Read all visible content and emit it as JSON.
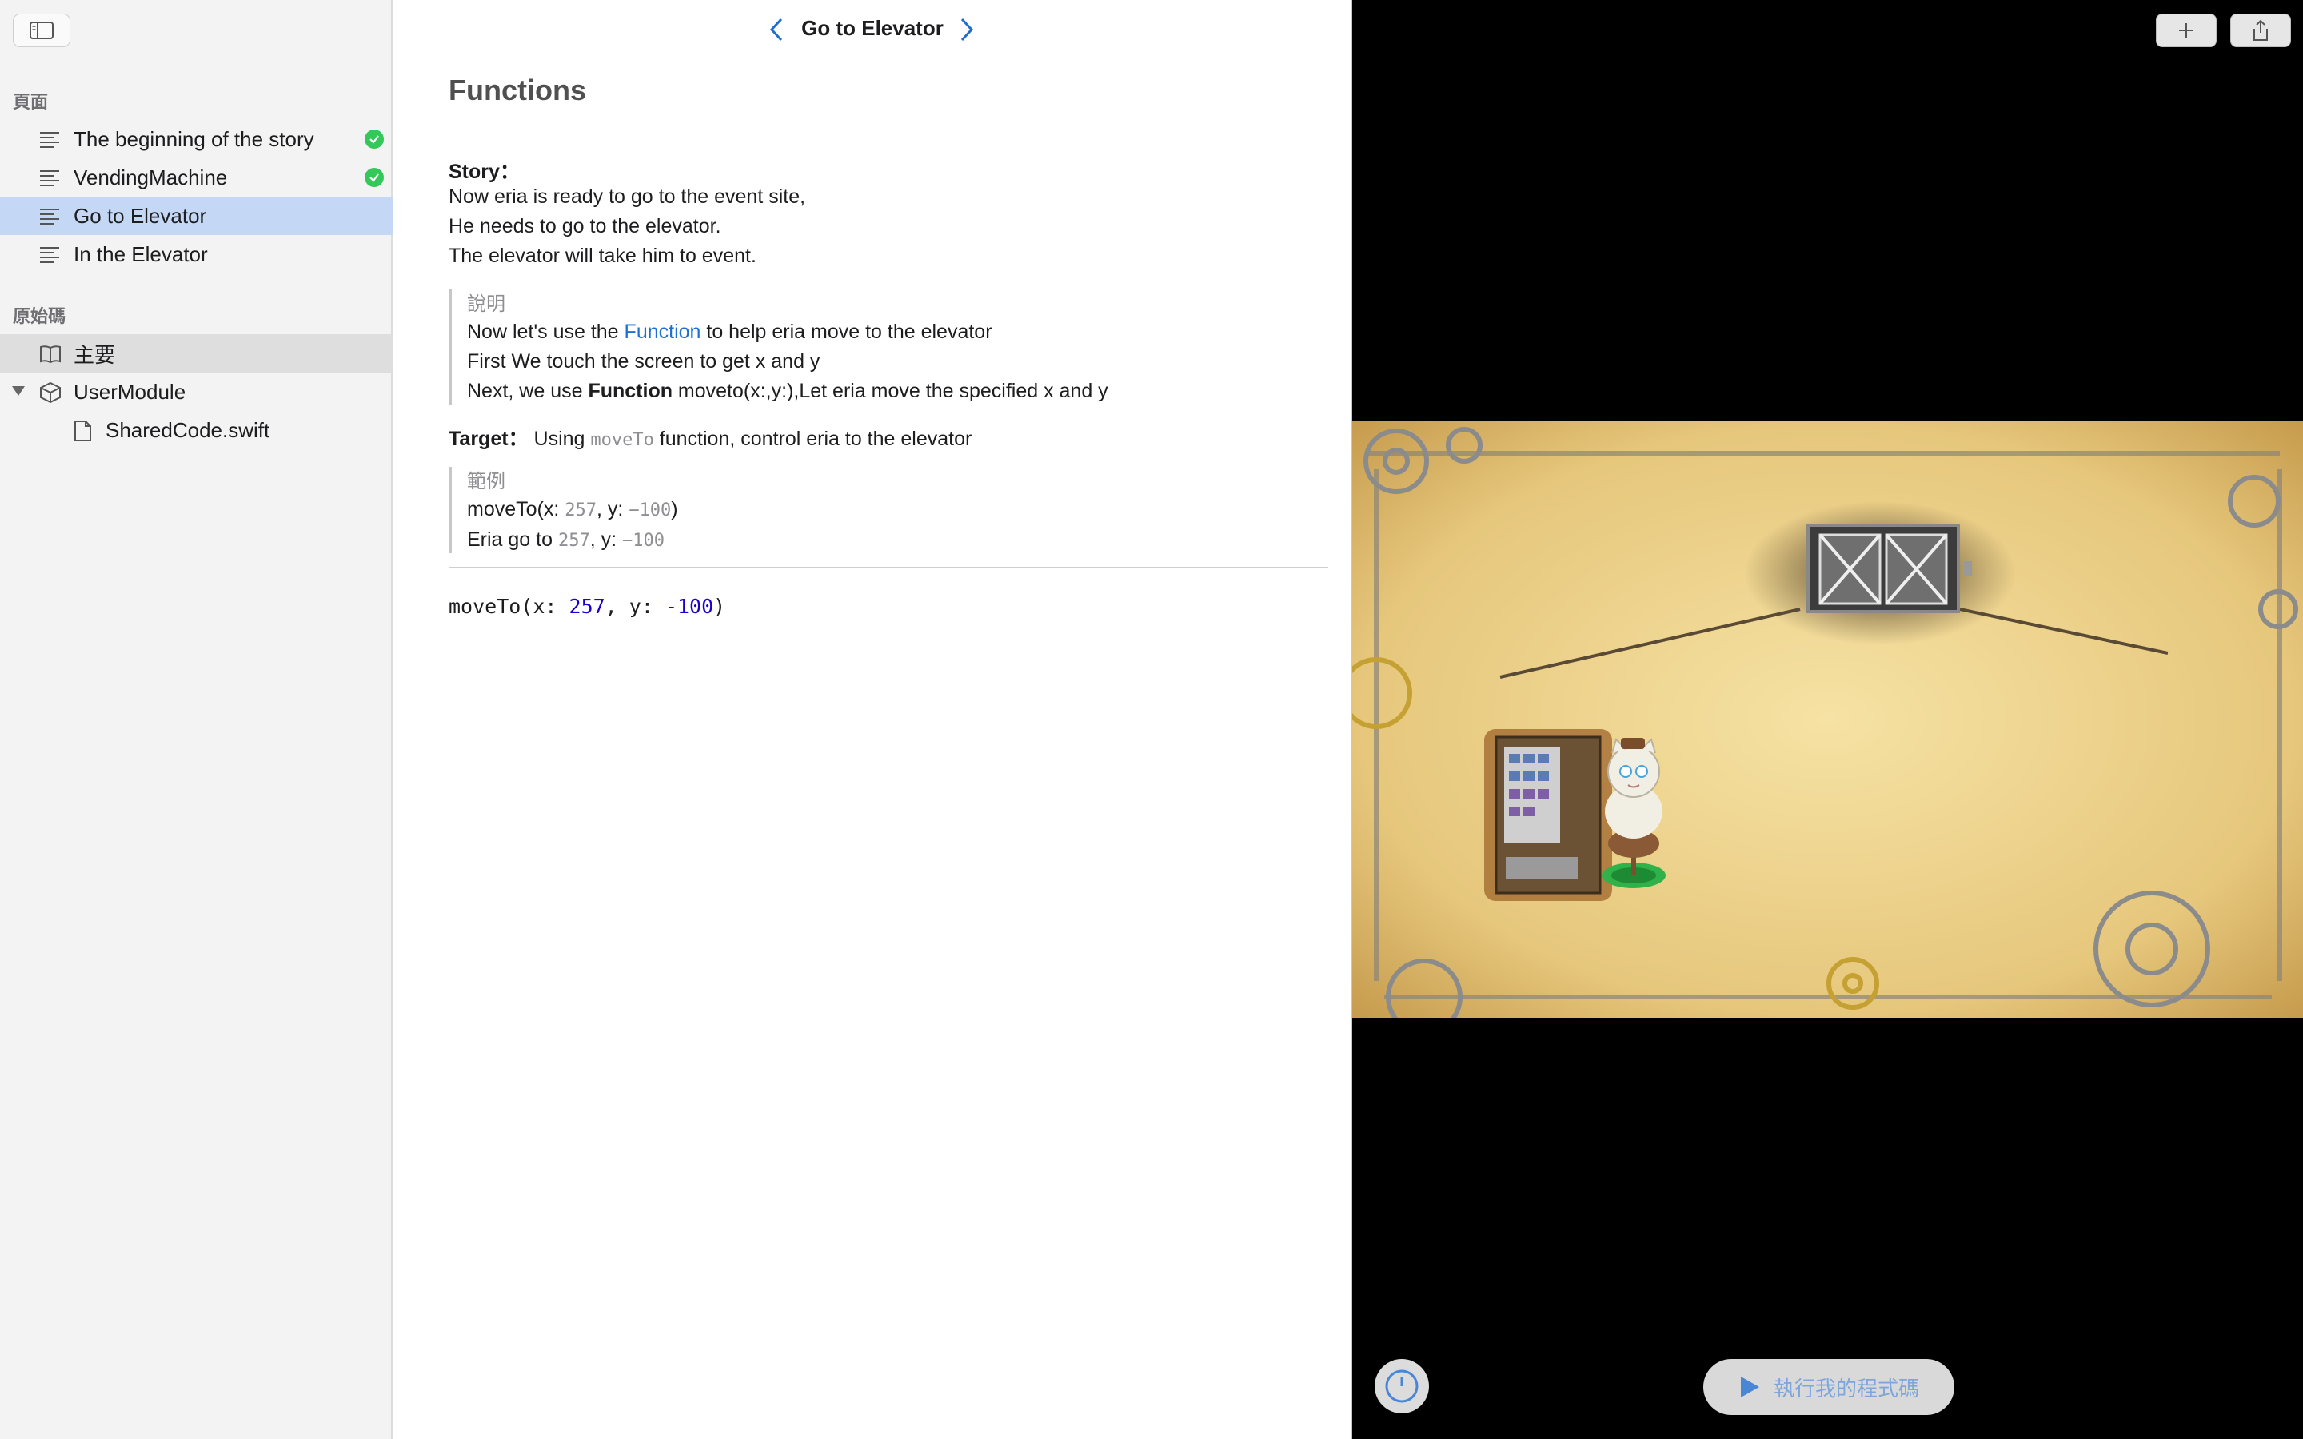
{
  "sidebar": {
    "pages_header": "頁面",
    "pages": [
      {
        "label": "The beginning of the story",
        "completed": true
      },
      {
        "label": "VendingMachine",
        "completed": true
      },
      {
        "label": "Go to Elevator",
        "completed": false,
        "selected": true
      },
      {
        "label": "In the Elevator",
        "completed": false
      }
    ],
    "source_header": "原始碼",
    "source_items": [
      {
        "label": "主要",
        "icon": "book-icon"
      },
      {
        "label": "UserModule",
        "icon": "module-box-icon"
      },
      {
        "label": "SharedCode.swift",
        "icon": "file-icon"
      }
    ]
  },
  "content": {
    "title": "Go to Elevator",
    "heading": "Functions",
    "story_label": "Story：",
    "story_lines": [
      "Now eria is ready to go to the event site,",
      "He needs to go to the elevator.",
      "The elevator will take him to event."
    ],
    "explain": {
      "title": "說明",
      "line1_prefix": "Now let's use the ",
      "line1_link": "Function",
      "line1_suffix": " to help eria move to the elevator",
      "line2": " First We touch the screen to get x and y",
      "line3_prefix": " Next, we use ",
      "line3_bold": "Function",
      "line3_suffix": " moveto(x:,y:),Let eria move the specified x and y"
    },
    "target": {
      "label": "Target：",
      "prefix": " Using ",
      "code": "moveTo",
      "suffix": " function, control eria to the elevator"
    },
    "example": {
      "title": "範例",
      "line1_a": "moveTo(x: ",
      "line1_x": "257",
      "line1_b": ", y: ",
      "line1_y": "−100",
      "line1_c": ")",
      "line2_a": " Eria go to ",
      "line2_x": "257",
      "line2_b": ", y: ",
      "line2_y": "−100"
    },
    "editor": {
      "fn": "moveTo(x: ",
      "x": "257",
      "mid": ", y: ",
      "y": "-100",
      "end": ")"
    }
  },
  "live_view": {
    "run_button_label": "執行我的程式碼"
  },
  "colors": {
    "accent": "#1f6fd1",
    "selected_row": "#c4d8f5",
    "check_green": "#34c759"
  }
}
